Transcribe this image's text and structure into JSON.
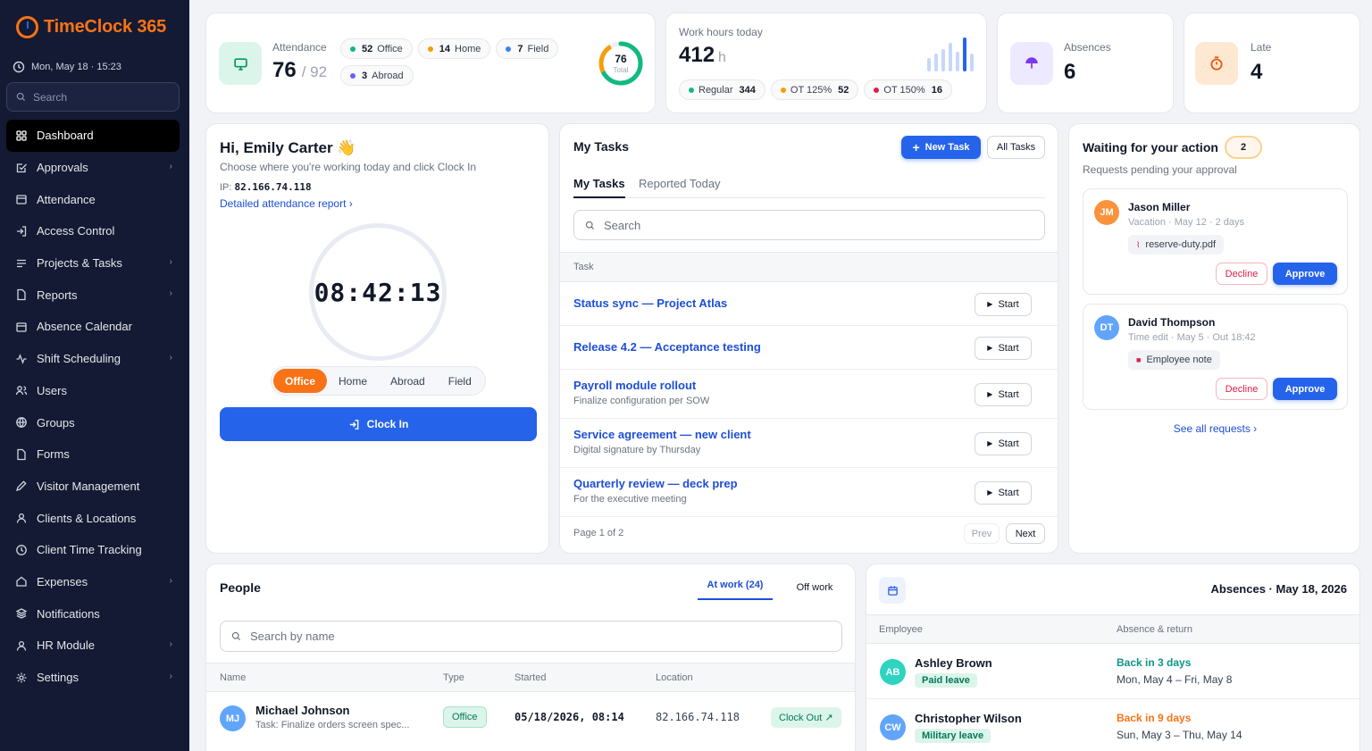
{
  "app": {
    "name": "TimeClock 365",
    "datetime": "Mon, May 18 · 15:23",
    "search_placeholder": "Search"
  },
  "nav": [
    {
      "label": "Dashboard",
      "icon": "grid-icon",
      "active": true,
      "chevron": false
    },
    {
      "label": "Approvals",
      "icon": "check-square-icon",
      "chevron": true
    },
    {
      "label": "Attendance",
      "icon": "calendar-icon",
      "chevron": false
    },
    {
      "label": "Access Control",
      "icon": "login-icon",
      "chevron": false
    },
    {
      "label": "Projects & Tasks",
      "icon": "list-icon",
      "chevron": true
    },
    {
      "label": "Reports",
      "icon": "file-icon",
      "chevron": true
    },
    {
      "label": "Absence Calendar",
      "icon": "calendar-icon",
      "chevron": false
    },
    {
      "label": "Shift Scheduling",
      "icon": "activity-icon",
      "chevron": true
    },
    {
      "label": "Users",
      "icon": "users-icon",
      "chevron": false
    },
    {
      "label": "Groups",
      "icon": "globe-icon",
      "chevron": false
    },
    {
      "label": "Forms",
      "icon": "file-icon",
      "chevron": false
    },
    {
      "label": "Visitor Management",
      "icon": "pen-icon",
      "chevron": false
    },
    {
      "label": "Clients & Locations",
      "icon": "user-icon",
      "chevron": false
    },
    {
      "label": "Client Time Tracking",
      "icon": "clock-icon",
      "chevron": false
    },
    {
      "label": "Expenses",
      "icon": "home-icon",
      "chevron": true
    },
    {
      "label": "Notifications",
      "icon": "layers-icon",
      "chevron": false
    },
    {
      "label": "HR Module",
      "icon": "user-icon",
      "chevron": true
    },
    {
      "label": "Settings",
      "icon": "gear-icon",
      "chevron": true
    }
  ],
  "attendance": {
    "label": "Attendance",
    "present": "76",
    "total": "/ 92",
    "chips": [
      {
        "count": "52",
        "label": "Office",
        "color": "#10b981"
      },
      {
        "count": "14",
        "label": "Home",
        "color": "#f59e0b"
      },
      {
        "count": "7",
        "label": "Field",
        "color": "#3b82f6"
      },
      {
        "count": "3",
        "label": "Abroad",
        "color": "#6366f1"
      }
    ],
    "ring_value": "76",
    "ring_label": "Total"
  },
  "work_hours": {
    "label": "Work hours today",
    "value": "412",
    "unit": "h",
    "chips": [
      {
        "label": "Regular",
        "value": "344",
        "color": "#10b981"
      },
      {
        "label": "OT 125%",
        "value": "52",
        "color": "#f59e0b"
      },
      {
        "label": "OT 150%",
        "value": "16",
        "color": "#e11d48"
      }
    ]
  },
  "absences_stat": {
    "label": "Absences",
    "value": "6"
  },
  "late_stat": {
    "label": "Late",
    "value": "4"
  },
  "clock": {
    "greeting": "Hi, Emily Carter 👋",
    "subtitle": "Choose where you're working today and click Clock In",
    "ip_label": "IP:",
    "ip": "82.166.74.118",
    "report_link": "Detailed attendance report ›",
    "time": "08:42:13",
    "locations": [
      "Office",
      "Home",
      "Abroad",
      "Field"
    ],
    "clock_in": "Clock In"
  },
  "tasks": {
    "title": "My Tasks",
    "new_task": "New Task",
    "all_tasks": "All Tasks",
    "tabs": [
      "My Tasks",
      "Reported Today"
    ],
    "search_placeholder": "Search",
    "column": "Task",
    "start_label": "Start",
    "items": [
      {
        "title": "Status sync — Project Atlas",
        "sub": ""
      },
      {
        "title": "Release 4.2 — Acceptance testing",
        "sub": ""
      },
      {
        "title": "Payroll module rollout",
        "sub": "Finalize configuration per SOW"
      },
      {
        "title": "Service agreement — new client",
        "sub": "Digital signature by Thursday"
      },
      {
        "title": "Quarterly review — deck prep",
        "sub": "For the executive meeting"
      }
    ],
    "page": "Page 1 of 2",
    "prev": "Prev",
    "next": "Next"
  },
  "waiting": {
    "title": "Waiting for your action",
    "count": "2",
    "subtitle": "Requests pending your approval",
    "decline": "Decline",
    "approve": "Approve",
    "requests": [
      {
        "initials": "JM",
        "name": "Jason Miller",
        "detail": "Vacation · May 12 · 2 days",
        "attachment": "reserve-duty.pdf",
        "color": "#fb923c"
      },
      {
        "initials": "DT",
        "name": "David Thompson",
        "detail": "Time edit · May 5 · Out 18:42",
        "attachment": "Employee note",
        "color": "#60a5fa"
      }
    ],
    "see_all": "See all requests ›"
  },
  "people": {
    "title": "People",
    "tab_at_work": "At work (24)",
    "tab_off_work": "Off work",
    "search_placeholder": "Search by name",
    "columns": [
      "Name",
      "Type",
      "Started",
      "Location"
    ],
    "rows": [
      {
        "initials": "MJ",
        "name": "Michael Johnson",
        "task": "Task: Finalize orders screen spec...",
        "type": "Office",
        "started": "05/18/2026, 08:14",
        "location": "82.166.74.118",
        "action": "Clock Out ↗"
      }
    ]
  },
  "absences": {
    "title": "Absences · May 18, 2026",
    "columns": [
      "Employee",
      "Absence & return"
    ],
    "rows": [
      {
        "initials": "AB",
        "name": "Ashley Brown",
        "type": "Paid leave",
        "back": "Back in 3 days",
        "range": "Mon, May 4 – Fri, May 8",
        "color": "#2dd4bf",
        "back_color": "#0d9488"
      },
      {
        "initials": "CW",
        "name": "Christopher Wilson",
        "type": "Military leave",
        "back": "Back in 9 days",
        "range": "Sun, May 3 – Thu, May 14",
        "color": "#60a5fa",
        "back_color": "#f97316"
      }
    ]
  },
  "colors": {
    "primary": "#2563eb",
    "accent": "#f97316",
    "sidebar": "#141a33",
    "success": "#10b981"
  }
}
